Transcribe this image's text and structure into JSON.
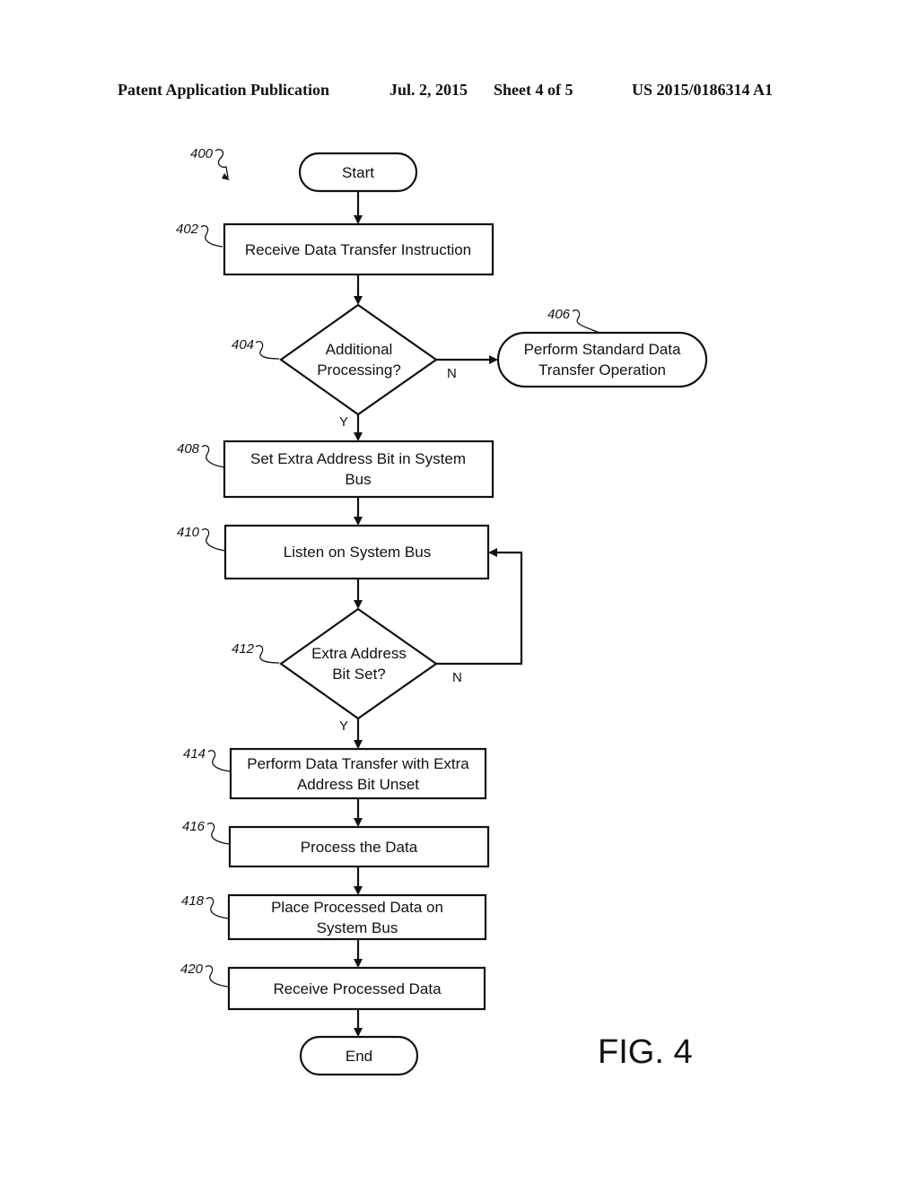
{
  "header": {
    "publication": "Patent Application Publication",
    "date": "Jul. 2, 2015",
    "sheet": "Sheet 4 of 5",
    "number": "US 2015/0186314 A1"
  },
  "figure": {
    "ref": "400",
    "label": "FIG. 4",
    "start": "Start",
    "end": "End",
    "steps": {
      "s402": {
        "ref": "402",
        "lines": [
          "Receive Data Transfer Instruction"
        ]
      },
      "s404": {
        "ref": "404",
        "lines": [
          "Additional",
          "Processing?"
        ],
        "yes": "Y",
        "no": "N"
      },
      "s406": {
        "ref": "406",
        "lines": [
          "Perform Standard Data",
          "Transfer Operation"
        ]
      },
      "s408": {
        "ref": "408",
        "lines": [
          "Set Extra Address Bit in System",
          "Bus"
        ]
      },
      "s410": {
        "ref": "410",
        "lines": [
          "Listen on System Bus"
        ]
      },
      "s412": {
        "ref": "412",
        "lines": [
          "Extra Address",
          "Bit Set?"
        ],
        "yes": "Y",
        "no": "N"
      },
      "s414": {
        "ref": "414",
        "lines": [
          "Perform Data Transfer with Extra",
          "Address Bit Unset"
        ]
      },
      "s416": {
        "ref": "416",
        "lines": [
          "Process the Data"
        ]
      },
      "s418": {
        "ref": "418",
        "lines": [
          "Place Processed Data on",
          "System Bus"
        ]
      },
      "s420": {
        "ref": "420",
        "lines": [
          "Receive Processed Data"
        ]
      }
    }
  }
}
